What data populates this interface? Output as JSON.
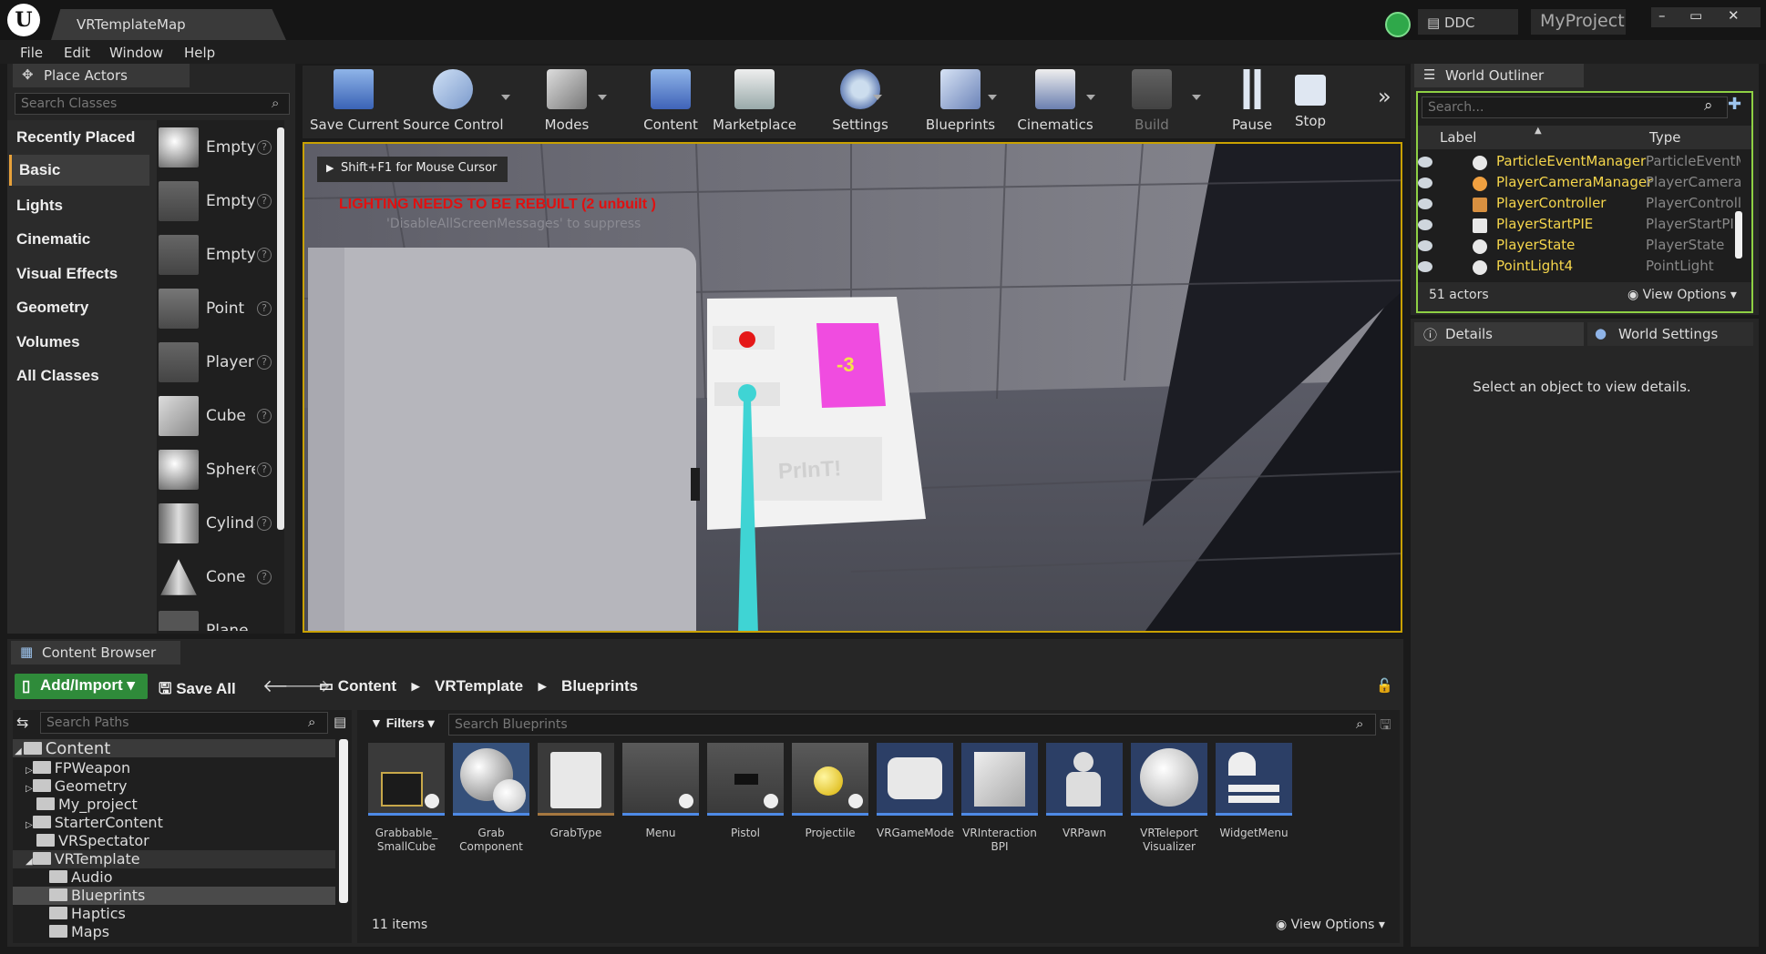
{
  "window": {
    "doc_tab": "VRTemplateMap",
    "ddc_label": "DDC",
    "project_name": "MyProject",
    "controls": [
      "–",
      "▭",
      "✕"
    ]
  },
  "menu": [
    "File",
    "Edit",
    "Window",
    "Help"
  ],
  "place_actors": {
    "tab_label": "Place Actors",
    "search_placeholder": "Search Classes",
    "categories": [
      "Recently Placed",
      "Basic",
      "Lights",
      "Cinematic",
      "Visual Effects",
      "Geometry",
      "Volumes",
      "All Classes"
    ],
    "active_category": "Basic",
    "actors": [
      "Empty",
      "Empty",
      "Empty",
      "Point",
      "Player",
      "Cube",
      "Sphere",
      "Cylinder",
      "Cone",
      "Plane"
    ]
  },
  "toolbar": {
    "items": [
      {
        "label": "Save Current",
        "icon": "save-icon"
      },
      {
        "label": "Source Control",
        "icon": "source-control-icon"
      },
      {
        "label": "Modes",
        "icon": "modes-icon"
      },
      {
        "label": "Content",
        "icon": "content-icon"
      },
      {
        "label": "Marketplace",
        "icon": "marketplace-icon"
      },
      {
        "label": "Settings",
        "icon": "settings-icon"
      },
      {
        "label": "Blueprints",
        "icon": "blueprints-icon"
      },
      {
        "label": "Cinematics",
        "icon": "cinematics-icon"
      },
      {
        "label": "Build",
        "icon": "build-icon"
      },
      {
        "label": "Pause",
        "icon": "pause-icon"
      },
      {
        "label": "Stop",
        "icon": "stop-icon"
      }
    ]
  },
  "viewport": {
    "mouse_hint": "Shift+F1 for Mouse Cursor",
    "lighting_warning": "LIGHTING NEEDS TO BE REBUILT (2 unbuilt )",
    "suppress_hint": "'DisableAllScreenMessages' to suppress",
    "menu_value": "-3",
    "print_button": "PrInT!",
    "colors": {
      "warning": "#e01010",
      "menu_panel": "#f04ce0",
      "pointer": "#3fd4d4"
    }
  },
  "outliner": {
    "tab_label": "World Outliner",
    "search_placeholder": "Search...",
    "col_label": "Label",
    "col_type": "Type",
    "rows": [
      {
        "label": "ParticleEventManager",
        "type": "ParticleEventManager"
      },
      {
        "label": "PlayerCameraManager",
        "type": "PlayerCameraManager"
      },
      {
        "label": "PlayerController",
        "type": "PlayerController"
      },
      {
        "label": "PlayerStartPIE",
        "type": "PlayerStartPIE"
      },
      {
        "label": "PlayerState",
        "type": "PlayerState"
      },
      {
        "label": "PointLight4",
        "type": "PointLight"
      }
    ],
    "actor_count": "51 actors",
    "view_options": "View Options"
  },
  "details": {
    "tab_details": "Details",
    "tab_world_settings": "World Settings",
    "empty_message": "Select an object to view details."
  },
  "content_browser": {
    "tab_label": "Content Browser",
    "add_import": "Add/Import",
    "save_all": "Save All",
    "breadcrumb": [
      "Content",
      "VRTemplate",
      "Blueprints"
    ],
    "search_paths_placeholder": "Search Paths",
    "filters_label": "Filters",
    "search_blueprints_placeholder": "Search Blueprints",
    "tree": [
      {
        "label": "Content",
        "depth": 0,
        "expanded": true
      },
      {
        "label": "FPWeapon",
        "depth": 1
      },
      {
        "label": "Geometry",
        "depth": 1
      },
      {
        "label": "My_project",
        "depth": 1
      },
      {
        "label": "StarterContent",
        "depth": 1
      },
      {
        "label": "VRSpectator",
        "depth": 1
      },
      {
        "label": "VRTemplate",
        "depth": 1,
        "expanded": true
      },
      {
        "label": "Audio",
        "depth": 2
      },
      {
        "label": "Blueprints",
        "depth": 2,
        "selected": true
      },
      {
        "label": "Haptics",
        "depth": 2
      },
      {
        "label": "Maps",
        "depth": 2
      }
    ],
    "assets": [
      "Grabbable_ SmallCube",
      "Grab Component",
      "GrabType",
      "Menu",
      "Pistol",
      "Projectile",
      "VRGameMode",
      "VRInteraction BPI",
      "VRPawn",
      "VRTeleport Visualizer",
      "WidgetMenu"
    ],
    "item_count": "11 items",
    "view_options": "View Options"
  }
}
